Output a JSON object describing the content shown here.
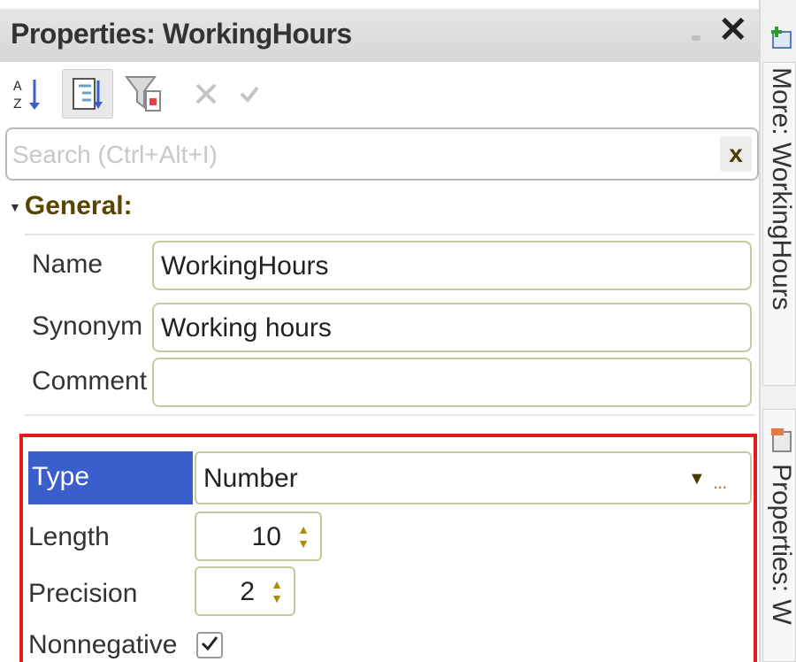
{
  "panel": {
    "title": "Properties: WorkingHours"
  },
  "search": {
    "placeholder": "Search (Ctrl+Alt+I)",
    "clear_label": "x"
  },
  "group": {
    "label": "General:"
  },
  "fields": [
    {
      "label": "Name",
      "value": "WorkingHours"
    },
    {
      "label": "Synonym",
      "value": "Working hours"
    },
    {
      "label": "Comment",
      "value": ""
    }
  ],
  "type_section": {
    "type_label": "Type",
    "type_value": "Number",
    "more_label": "...",
    "length_label": "Length",
    "length_value": "10",
    "precision_label": "Precision",
    "precision_value": "2",
    "nonnegative_label": "Nonnegative",
    "nonnegative_checked": true
  },
  "side_tabs": [
    {
      "label": "More: WorkingHours"
    },
    {
      "label": "Properties: W"
    }
  ],
  "colors": {
    "accent": "#3a5fcd",
    "highlight_border": "#e31b1b",
    "group_text": "#5a4500"
  },
  "toolbar": {
    "icons": [
      "sort-az-icon",
      "tree-view-icon",
      "filter-icon",
      "delete-icon",
      "check-icon"
    ]
  }
}
